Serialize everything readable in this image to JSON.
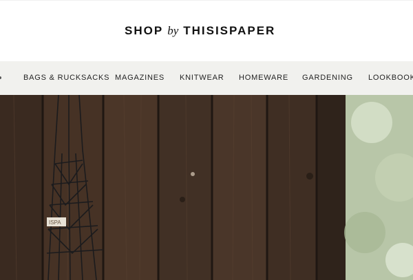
{
  "brand": {
    "part1": "SHOP",
    "part2": "by",
    "part3": "THISISPAPER"
  },
  "nav": {
    "items": [
      {
        "label": "BAGS & RUCKSACKS"
      },
      {
        "label": "MAGAZINES"
      },
      {
        "label": "KNITWEAR"
      },
      {
        "label": "HOMEWARE"
      },
      {
        "label": "GARDENING"
      },
      {
        "label": "LOOKBOOK"
      }
    ]
  },
  "hero": {
    "bag_tag_text": "ISPA",
    "colors": {
      "wood_dark": "#2c211a",
      "wood_mid": "#4a3527",
      "foliage": "#c9d4bc"
    }
  }
}
